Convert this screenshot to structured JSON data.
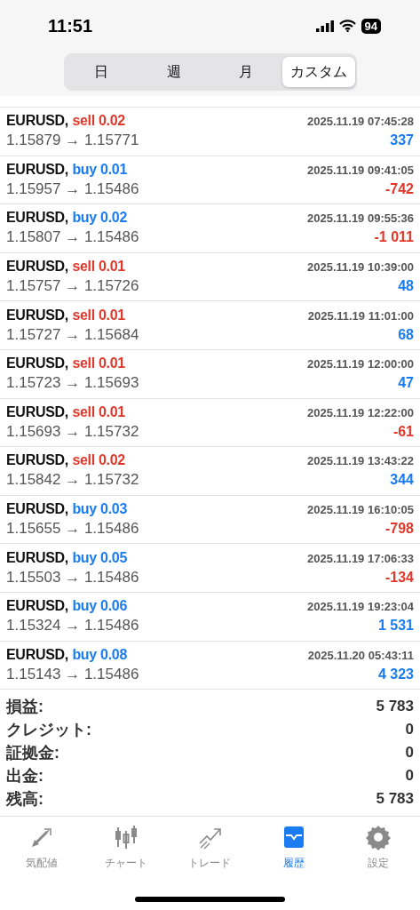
{
  "status_bar": {
    "time": "11:51",
    "battery": "94"
  },
  "segments": [
    {
      "label": "日",
      "selected": false
    },
    {
      "label": "週",
      "selected": false
    },
    {
      "label": "月",
      "selected": false
    },
    {
      "label": "カスタム",
      "selected": true
    }
  ],
  "deals": [
    {
      "symbol": "EURUSD,",
      "order": "sell 0.02",
      "kind": "sell",
      "time": "2025.11.19 07:45:28",
      "prices": "1.15879 → 1.15771",
      "profit": "337",
      "loss": false
    },
    {
      "symbol": "EURUSD,",
      "order": "buy 0.01",
      "kind": "buy",
      "time": "2025.11.19 09:41:05",
      "prices": "1.15957 → 1.15486",
      "profit": "-742",
      "loss": true
    },
    {
      "symbol": "EURUSD,",
      "order": "buy 0.02",
      "kind": "buy",
      "time": "2025.11.19 09:55:36",
      "prices": "1.15807 → 1.15486",
      "profit": "-1 011",
      "loss": true
    },
    {
      "symbol": "EURUSD,",
      "order": "sell 0.01",
      "kind": "sell",
      "time": "2025.11.19 10:39:00",
      "prices": "1.15757 → 1.15726",
      "profit": "48",
      "loss": false
    },
    {
      "symbol": "EURUSD,",
      "order": "sell 0.01",
      "kind": "sell",
      "time": "2025.11.19 11:01:00",
      "prices": "1.15727 → 1.15684",
      "profit": "68",
      "loss": false
    },
    {
      "symbol": "EURUSD,",
      "order": "sell 0.01",
      "kind": "sell",
      "time": "2025.11.19 12:00:00",
      "prices": "1.15723 → 1.15693",
      "profit": "47",
      "loss": false
    },
    {
      "symbol": "EURUSD,",
      "order": "sell 0.01",
      "kind": "sell",
      "time": "2025.11.19 12:22:00",
      "prices": "1.15693 → 1.15732",
      "profit": "-61",
      "loss": true
    },
    {
      "symbol": "EURUSD,",
      "order": "sell 0.02",
      "kind": "sell",
      "time": "2025.11.19 13:43:22",
      "prices": "1.15842 → 1.15732",
      "profit": "344",
      "loss": false
    },
    {
      "symbol": "EURUSD,",
      "order": "buy 0.03",
      "kind": "buy",
      "time": "2025.11.19 16:10:05",
      "prices": "1.15655 → 1.15486",
      "profit": "-798",
      "loss": true
    },
    {
      "symbol": "EURUSD,",
      "order": "buy 0.05",
      "kind": "buy",
      "time": "2025.11.19 17:06:33",
      "prices": "1.15503 → 1.15486",
      "profit": "-134",
      "loss": true
    },
    {
      "symbol": "EURUSD,",
      "order": "buy 0.06",
      "kind": "buy",
      "time": "2025.11.19 19:23:04",
      "prices": "1.15324 → 1.15486",
      "profit": "1 531",
      "loss": false
    },
    {
      "symbol": "EURUSD,",
      "order": "buy 0.08",
      "kind": "buy",
      "time": "2025.11.20 05:43:11",
      "prices": "1.15143 → 1.15486",
      "profit": "4 323",
      "loss": false
    }
  ],
  "summary": [
    {
      "label": "損益:",
      "value": "5 783"
    },
    {
      "label": "クレジット:",
      "value": "0"
    },
    {
      "label": "証拠金:",
      "value": "0"
    },
    {
      "label": "出金:",
      "value": "0"
    },
    {
      "label": "残高:",
      "value": "5 783"
    }
  ],
  "tab_bar": [
    {
      "kind": "quotes",
      "label": "気配値",
      "selected": false
    },
    {
      "kind": "chart",
      "label": "チャート",
      "selected": false
    },
    {
      "kind": "trade",
      "label": "トレード",
      "selected": false
    },
    {
      "kind": "history",
      "label": "履歴",
      "selected": true
    },
    {
      "kind": "settings",
      "label": "設定",
      "selected": false
    }
  ]
}
